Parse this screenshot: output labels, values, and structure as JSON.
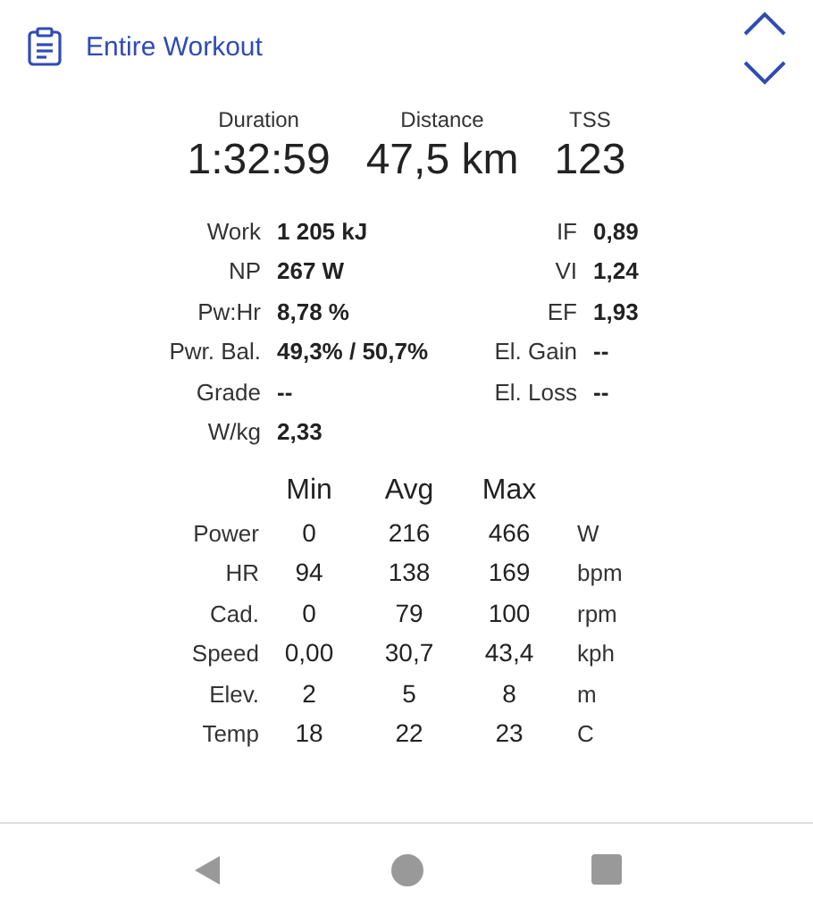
{
  "header": {
    "title": "Entire Workout"
  },
  "summary": [
    {
      "label": "Duration",
      "value": "1:32:59"
    },
    {
      "label": "Distance",
      "value": "47,5 km"
    },
    {
      "label": "TSS",
      "value": "123"
    }
  ],
  "details": [
    {
      "left": {
        "label": "Work",
        "value": "1 205 kJ"
      },
      "right": {
        "label": "IF",
        "value": "0,89"
      }
    },
    {
      "left": {
        "label": "NP",
        "value": "267 W"
      },
      "right": {
        "label": "VI",
        "value": "1,24"
      }
    },
    {
      "left": {
        "label": "Pw:Hr",
        "value": "8,78 %"
      },
      "right": {
        "label": "EF",
        "value": "1,93"
      }
    },
    {
      "left": {
        "label": "Pwr. Bal.",
        "value": "49,3% / 50,7%"
      },
      "right": {
        "label": "El. Gain",
        "value": "--"
      }
    },
    {
      "left": {
        "label": "Grade",
        "value": "--"
      },
      "right": {
        "label": "El. Loss",
        "value": "--"
      }
    },
    {
      "left": {
        "label": "W/kg",
        "value": "2,33"
      }
    }
  ],
  "table": {
    "columns": [
      "Min",
      "Avg",
      "Max"
    ],
    "rows": [
      {
        "label": "Power",
        "values": [
          "0",
          "216",
          "466"
        ],
        "unit": "W"
      },
      {
        "label": "HR",
        "values": [
          "94",
          "138",
          "169"
        ],
        "unit": "bpm"
      },
      {
        "label": "Cad.",
        "values": [
          "0",
          "79",
          "100"
        ],
        "unit": "rpm"
      },
      {
        "label": "Speed",
        "values": [
          "0,00",
          "30,7",
          "43,4"
        ],
        "unit": "kph"
      },
      {
        "label": "Elev.",
        "values": [
          "2",
          "5",
          "8"
        ],
        "unit": "m"
      },
      {
        "label": "Temp",
        "values": [
          "18",
          "22",
          "23"
        ],
        "unit": "C"
      }
    ]
  }
}
